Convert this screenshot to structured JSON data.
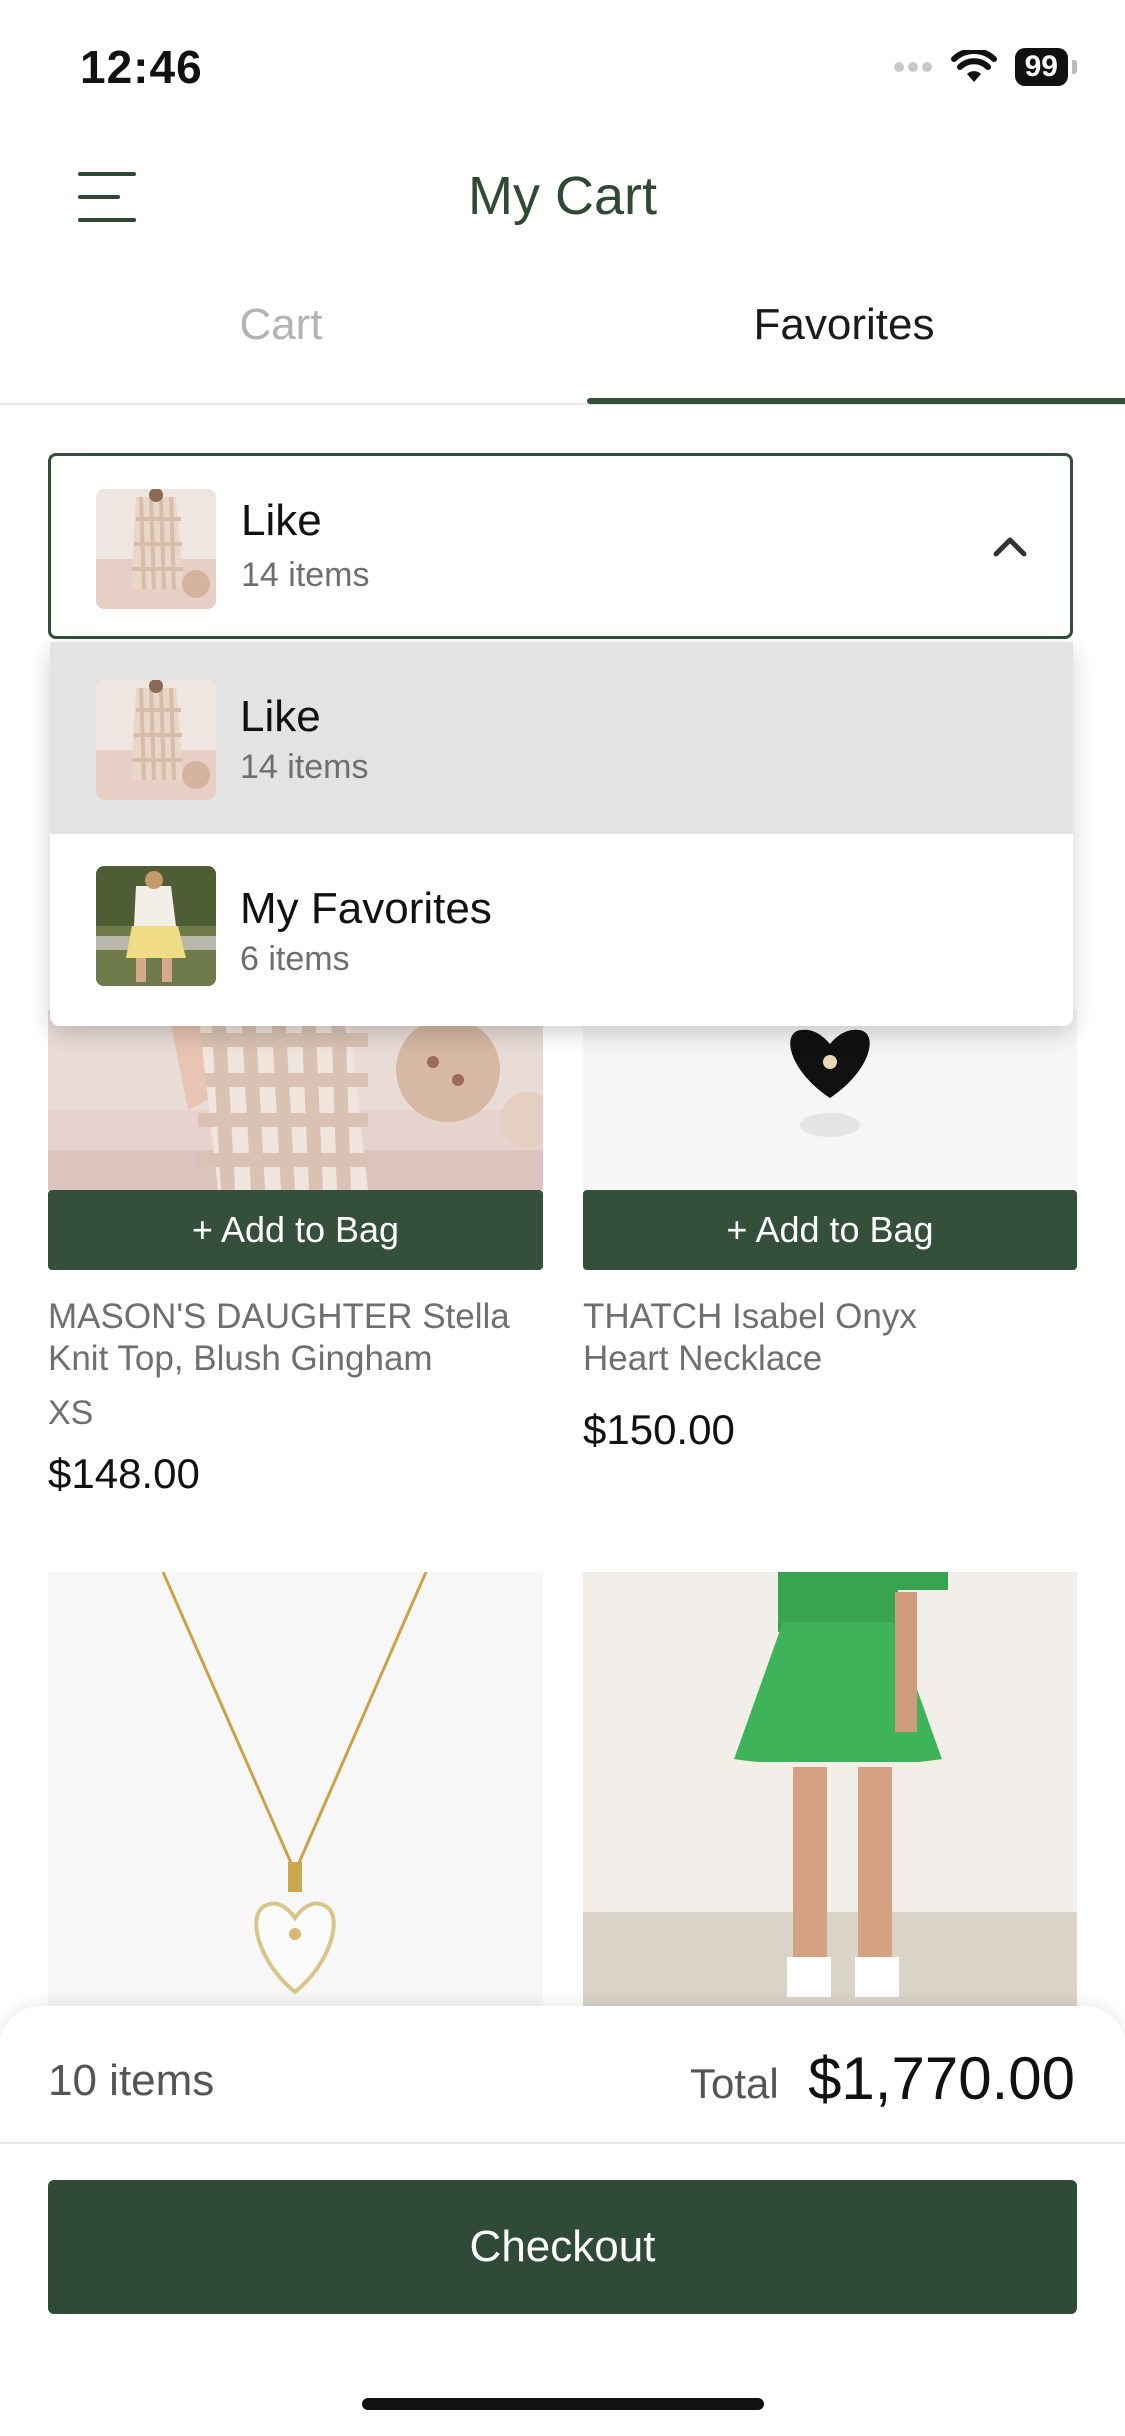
{
  "status_bar": {
    "time": "12:46",
    "battery": "99"
  },
  "header": {
    "title": "My Cart"
  },
  "tabs": [
    {
      "label": "Cart",
      "active": false
    },
    {
      "label": "Favorites",
      "active": true
    }
  ],
  "dropdown": {
    "selected": {
      "name": "Like",
      "count": "14 items"
    },
    "options": [
      {
        "name": "Like",
        "count": "14 items",
        "active": true
      },
      {
        "name": "My Favorites",
        "count": "6 items",
        "active": false
      }
    ]
  },
  "products": [
    {
      "add_label": "+ Add to Bag",
      "name_line1": "MASON'S DAUGHTER Stella",
      "name_line2": "Knit Top, Blush Gingham",
      "size": "XS",
      "price": "$148.00"
    },
    {
      "add_label": "+ Add to Bag",
      "name_line1": "THATCH Isabel Onyx",
      "name_line2": "Heart Necklace",
      "size": "",
      "price": "$150.00"
    }
  ],
  "summary": {
    "items": "10 items",
    "total_label": "Total",
    "total_value": "$1,770.00",
    "checkout_label": "Checkout"
  },
  "colors": {
    "brand": "#34503a",
    "title": "#2f4a33",
    "inactive_tab": "#b3b3b3"
  }
}
